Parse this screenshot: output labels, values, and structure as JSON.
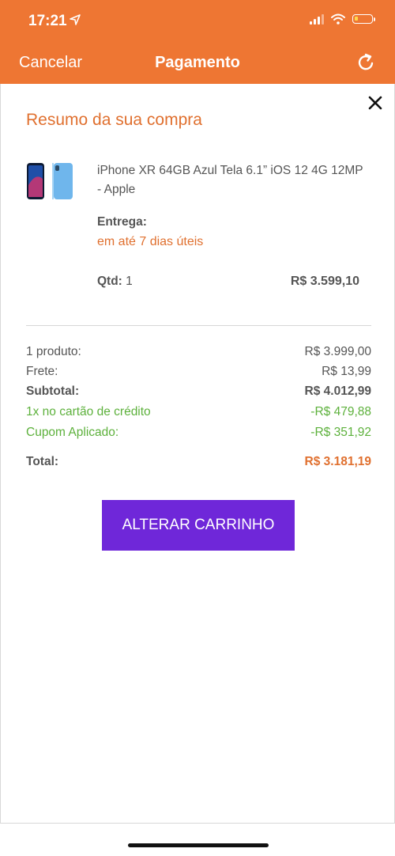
{
  "status_bar": {
    "time": "17:21"
  },
  "nav": {
    "cancel_label": "Cancelar",
    "title": "Pagamento"
  },
  "summary": {
    "title": "Resumo da sua compra",
    "product": {
      "name": "iPhone XR 64GB Azul Tela 6.1” iOS 12 4G 12MP - Apple",
      "delivery_label": "Entrega:",
      "delivery_value": "em até 7 dias úteis",
      "qty_label": "Qtd:",
      "qty_value": "1",
      "price": "R$ 3.599,10"
    },
    "rows": [
      {
        "label": "1 produto:",
        "value": "R$ 3.999,00"
      },
      {
        "label": "Frete:",
        "value": "R$ 13,99"
      },
      {
        "label": "Subtotal:",
        "value": "R$ 4.012,99"
      },
      {
        "label": "1x no cartão de crédito",
        "value": "-R$ 479,88"
      },
      {
        "label": "Cupom Aplicado:",
        "value": "-R$ 351,92"
      }
    ],
    "total": {
      "label": "Total:",
      "value": "R$ 3.181,19"
    }
  },
  "cta": {
    "label": "ALTERAR CARRINHO"
  },
  "colors": {
    "header": "#EE7633",
    "accent": "#E0702F",
    "discount": "#5DB13C",
    "button": "#6F27D9"
  },
  "icons": [
    "location-arrow-icon",
    "signal-icon",
    "wifi-icon",
    "battery-icon",
    "refresh-icon",
    "close-icon",
    "product-thumbnail"
  ]
}
